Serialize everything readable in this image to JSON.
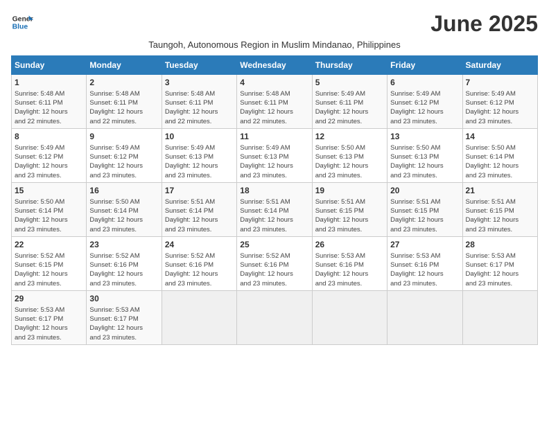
{
  "logo": {
    "line1": "General",
    "line2": "Blue"
  },
  "title": "June 2025",
  "subtitle": "Taungoh, Autonomous Region in Muslim Mindanao, Philippines",
  "days_header": [
    "Sunday",
    "Monday",
    "Tuesday",
    "Wednesday",
    "Thursday",
    "Friday",
    "Saturday"
  ],
  "weeks": [
    [
      {
        "day": "1",
        "info": "Sunrise: 5:48 AM\nSunset: 6:11 PM\nDaylight: 12 hours\nand 22 minutes."
      },
      {
        "day": "2",
        "info": "Sunrise: 5:48 AM\nSunset: 6:11 PM\nDaylight: 12 hours\nand 22 minutes."
      },
      {
        "day": "3",
        "info": "Sunrise: 5:48 AM\nSunset: 6:11 PM\nDaylight: 12 hours\nand 22 minutes."
      },
      {
        "day": "4",
        "info": "Sunrise: 5:48 AM\nSunset: 6:11 PM\nDaylight: 12 hours\nand 22 minutes."
      },
      {
        "day": "5",
        "info": "Sunrise: 5:49 AM\nSunset: 6:11 PM\nDaylight: 12 hours\nand 22 minutes."
      },
      {
        "day": "6",
        "info": "Sunrise: 5:49 AM\nSunset: 6:12 PM\nDaylight: 12 hours\nand 23 minutes."
      },
      {
        "day": "7",
        "info": "Sunrise: 5:49 AM\nSunset: 6:12 PM\nDaylight: 12 hours\nand 23 minutes."
      }
    ],
    [
      {
        "day": "8",
        "info": "Sunrise: 5:49 AM\nSunset: 6:12 PM\nDaylight: 12 hours\nand 23 minutes."
      },
      {
        "day": "9",
        "info": "Sunrise: 5:49 AM\nSunset: 6:12 PM\nDaylight: 12 hours\nand 23 minutes."
      },
      {
        "day": "10",
        "info": "Sunrise: 5:49 AM\nSunset: 6:13 PM\nDaylight: 12 hours\nand 23 minutes."
      },
      {
        "day": "11",
        "info": "Sunrise: 5:49 AM\nSunset: 6:13 PM\nDaylight: 12 hours\nand 23 minutes."
      },
      {
        "day": "12",
        "info": "Sunrise: 5:50 AM\nSunset: 6:13 PM\nDaylight: 12 hours\nand 23 minutes."
      },
      {
        "day": "13",
        "info": "Sunrise: 5:50 AM\nSunset: 6:13 PM\nDaylight: 12 hours\nand 23 minutes."
      },
      {
        "day": "14",
        "info": "Sunrise: 5:50 AM\nSunset: 6:14 PM\nDaylight: 12 hours\nand 23 minutes."
      }
    ],
    [
      {
        "day": "15",
        "info": "Sunrise: 5:50 AM\nSunset: 6:14 PM\nDaylight: 12 hours\nand 23 minutes."
      },
      {
        "day": "16",
        "info": "Sunrise: 5:50 AM\nSunset: 6:14 PM\nDaylight: 12 hours\nand 23 minutes."
      },
      {
        "day": "17",
        "info": "Sunrise: 5:51 AM\nSunset: 6:14 PM\nDaylight: 12 hours\nand 23 minutes."
      },
      {
        "day": "18",
        "info": "Sunrise: 5:51 AM\nSunset: 6:14 PM\nDaylight: 12 hours\nand 23 minutes."
      },
      {
        "day": "19",
        "info": "Sunrise: 5:51 AM\nSunset: 6:15 PM\nDaylight: 12 hours\nand 23 minutes."
      },
      {
        "day": "20",
        "info": "Sunrise: 5:51 AM\nSunset: 6:15 PM\nDaylight: 12 hours\nand 23 minutes."
      },
      {
        "day": "21",
        "info": "Sunrise: 5:51 AM\nSunset: 6:15 PM\nDaylight: 12 hours\nand 23 minutes."
      }
    ],
    [
      {
        "day": "22",
        "info": "Sunrise: 5:52 AM\nSunset: 6:15 PM\nDaylight: 12 hours\nand 23 minutes."
      },
      {
        "day": "23",
        "info": "Sunrise: 5:52 AM\nSunset: 6:16 PM\nDaylight: 12 hours\nand 23 minutes."
      },
      {
        "day": "24",
        "info": "Sunrise: 5:52 AM\nSunset: 6:16 PM\nDaylight: 12 hours\nand 23 minutes."
      },
      {
        "day": "25",
        "info": "Sunrise: 5:52 AM\nSunset: 6:16 PM\nDaylight: 12 hours\nand 23 minutes."
      },
      {
        "day": "26",
        "info": "Sunrise: 5:53 AM\nSunset: 6:16 PM\nDaylight: 12 hours\nand 23 minutes."
      },
      {
        "day": "27",
        "info": "Sunrise: 5:53 AM\nSunset: 6:16 PM\nDaylight: 12 hours\nand 23 minutes."
      },
      {
        "day": "28",
        "info": "Sunrise: 5:53 AM\nSunset: 6:17 PM\nDaylight: 12 hours\nand 23 minutes."
      }
    ],
    [
      {
        "day": "29",
        "info": "Sunrise: 5:53 AM\nSunset: 6:17 PM\nDaylight: 12 hours\nand 23 minutes."
      },
      {
        "day": "30",
        "info": "Sunrise: 5:53 AM\nSunset: 6:17 PM\nDaylight: 12 hours\nand 23 minutes."
      },
      {
        "day": "",
        "info": ""
      },
      {
        "day": "",
        "info": ""
      },
      {
        "day": "",
        "info": ""
      },
      {
        "day": "",
        "info": ""
      },
      {
        "day": "",
        "info": ""
      }
    ]
  ]
}
